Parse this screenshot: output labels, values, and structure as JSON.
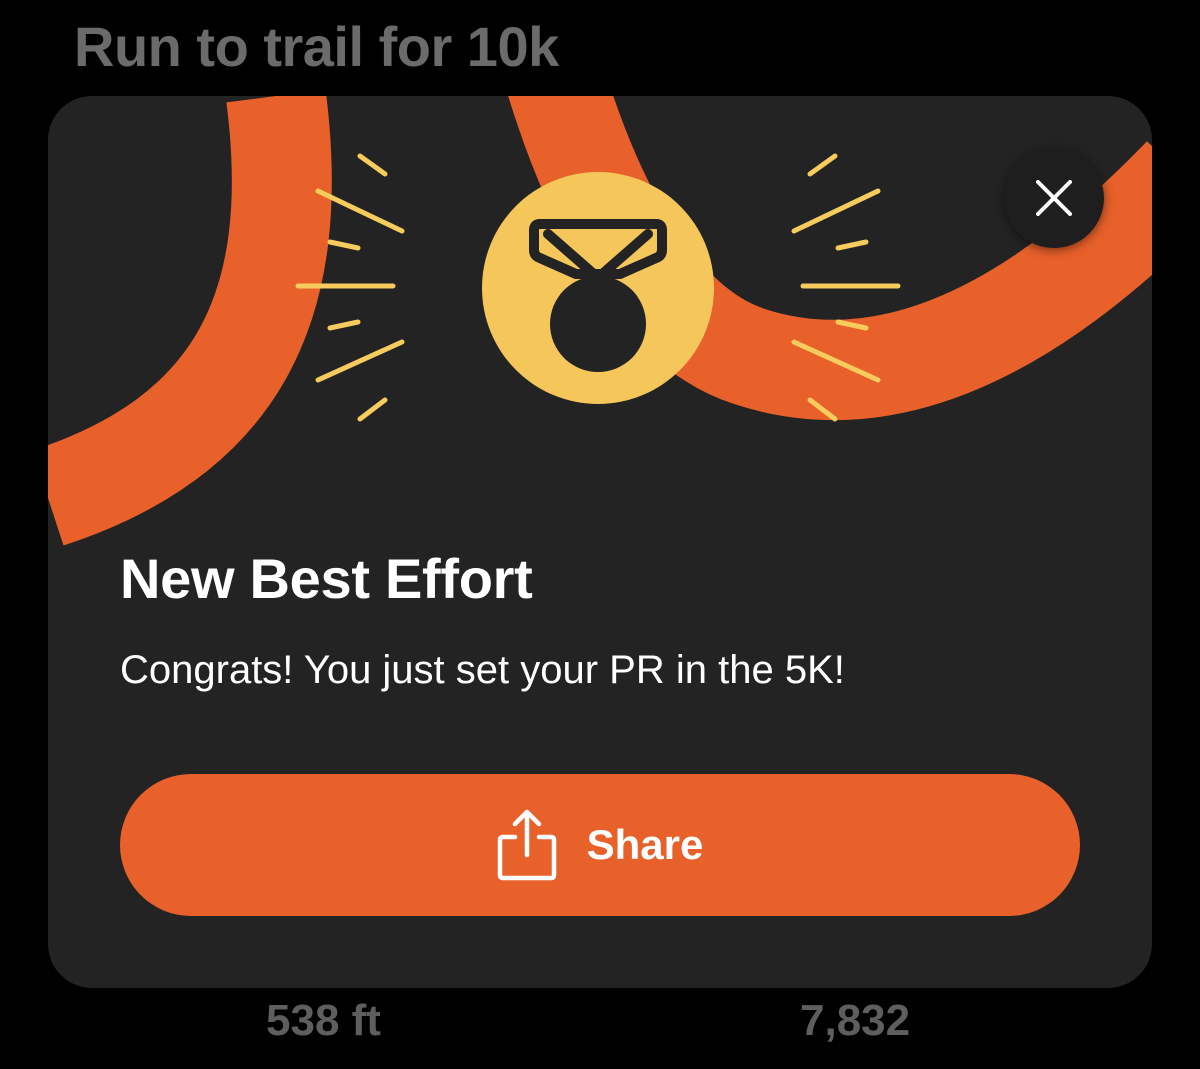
{
  "background": {
    "title": "Run to trail for 10k",
    "stats": [
      {
        "value": "538 ft"
      },
      {
        "value": "7,832"
      }
    ]
  },
  "modal": {
    "title": "New Best Effort",
    "message": "Congrats! You just set your PR in the 5K!",
    "share_button": {
      "label": "Share",
      "icon": "share-icon"
    },
    "close_button": {
      "icon": "close-icon"
    },
    "badge_icon": "medal-icon"
  },
  "colors": {
    "background": "#000000",
    "modal": "#232323",
    "accent_orange": "#e8602a",
    "medal_yellow": "#f5c65a",
    "burst_yellow": "#f7cc5c",
    "muted_text": "#6b6b6b"
  }
}
